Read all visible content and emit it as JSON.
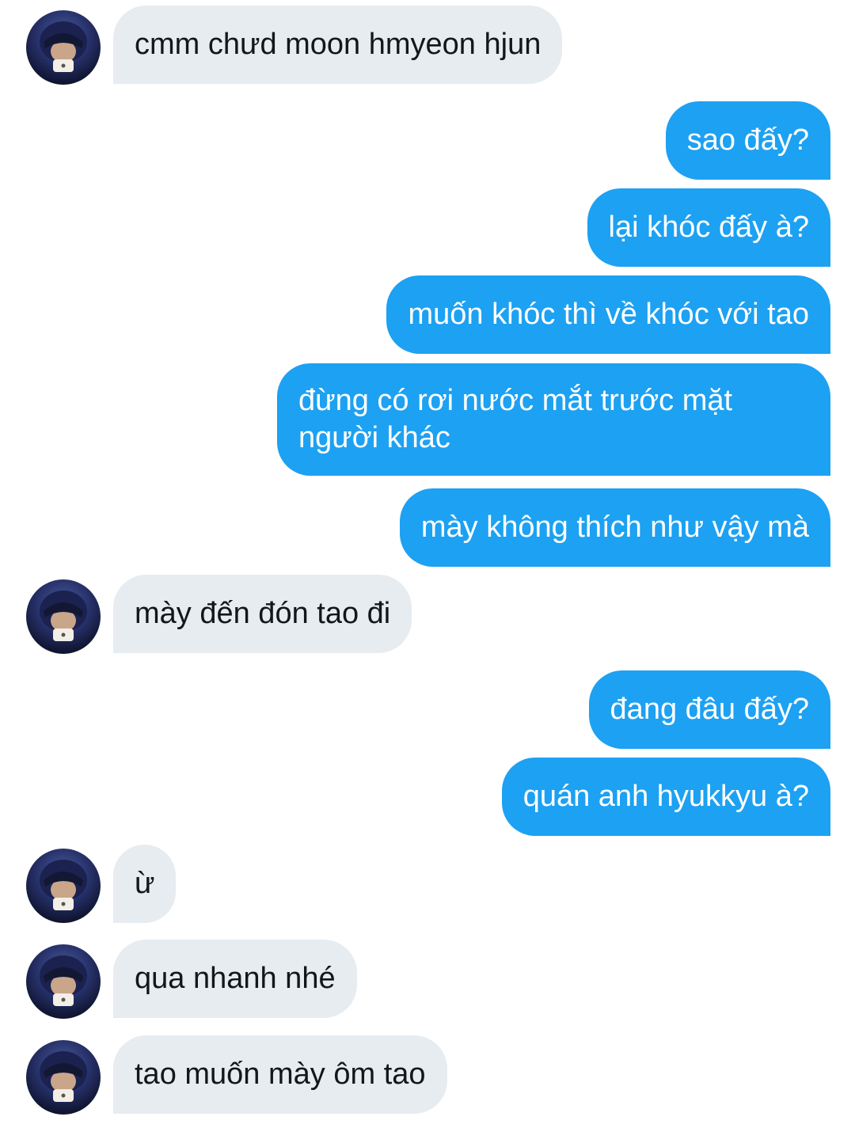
{
  "messages": [
    {
      "from": "them",
      "text": "cmm chưd moon hmyeon hjun"
    },
    {
      "from": "me",
      "text": "sao đấy?"
    },
    {
      "from": "me",
      "text": "lại khóc đấy à?"
    },
    {
      "from": "me",
      "text": "muốn khóc thì về khóc với tao"
    },
    {
      "from": "me",
      "text": "đừng có rơi nước mắt trước mặt người khác"
    },
    {
      "from": "me",
      "text": "mày không thích như vậy mà"
    },
    {
      "from": "them",
      "text": "mày đến đón tao đi"
    },
    {
      "from": "me",
      "text": "đang đâu đấy?"
    },
    {
      "from": "me",
      "text": "quán anh hyukkyu à?"
    },
    {
      "from": "them",
      "text": "ừ"
    },
    {
      "from": "them",
      "text": "qua nhanh nhé"
    },
    {
      "from": "them",
      "text": "tao muốn mày ôm tao"
    }
  ],
  "colors": {
    "outgoing_bubble": "#1da1f2",
    "incoming_bubble": "#e6ecf0",
    "incoming_text": "#14171a",
    "outgoing_text": "#ffffff"
  },
  "avatar": {
    "icon": "user-avatar-icon"
  }
}
